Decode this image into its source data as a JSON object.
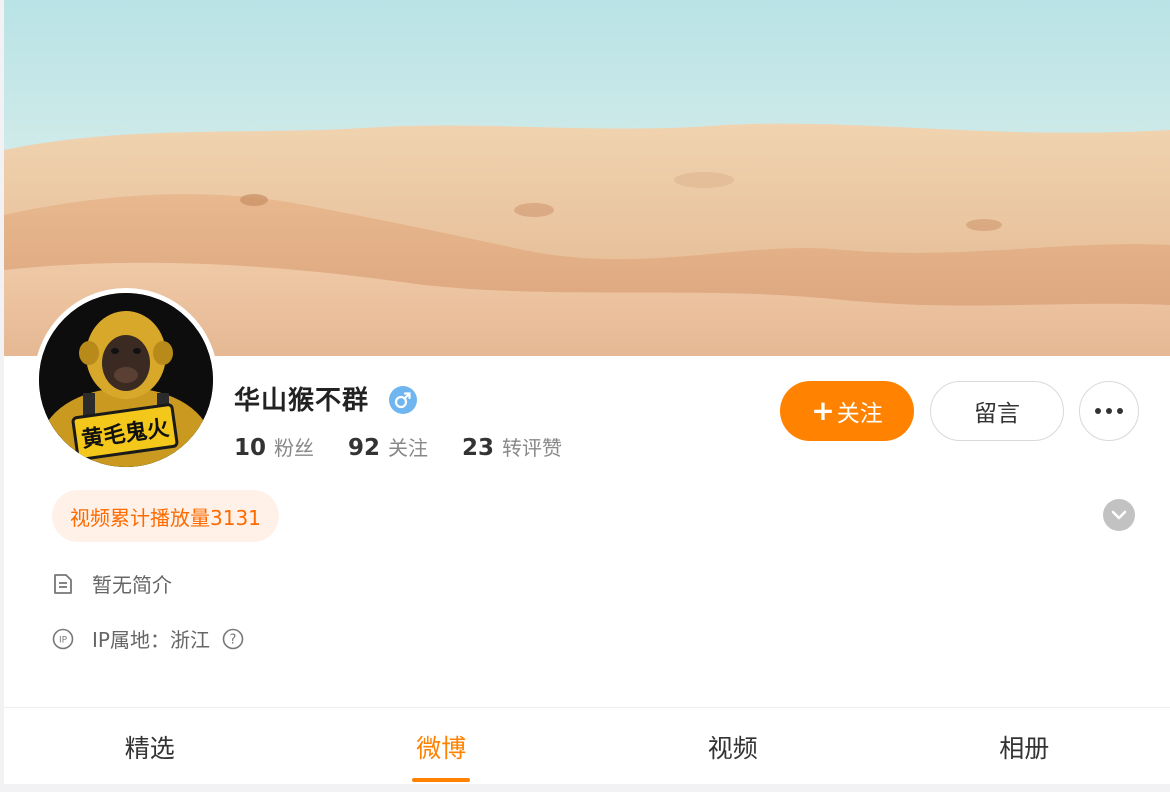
{
  "profile": {
    "name": "华山猴不群",
    "gender_icon": "male-icon",
    "avatar_plate_text": "黄毛鬼火",
    "stats": [
      {
        "num": "10",
        "label": "粉丝"
      },
      {
        "num": "92",
        "label": "关注"
      },
      {
        "num": "23",
        "label": "转评赞"
      }
    ]
  },
  "actions": {
    "follow_plus": "+",
    "follow_label": "关注",
    "message_label": "留言",
    "more_icon": "more-dots-icon"
  },
  "badge": {
    "text": "视频累计播放量3131"
  },
  "info": {
    "bio": "暂无简介",
    "ip_label": "IP属地：浙江"
  },
  "tabs": [
    {
      "label": "精选",
      "active": false
    },
    {
      "label": "微博",
      "active": true
    },
    {
      "label": "视频",
      "active": false
    },
    {
      "label": "相册",
      "active": false
    }
  ],
  "colors": {
    "accent": "#ff8200",
    "badge_bg": "#fff1e8",
    "badge_text": "#ff6a00",
    "gender_bg": "#6fb5f0"
  }
}
